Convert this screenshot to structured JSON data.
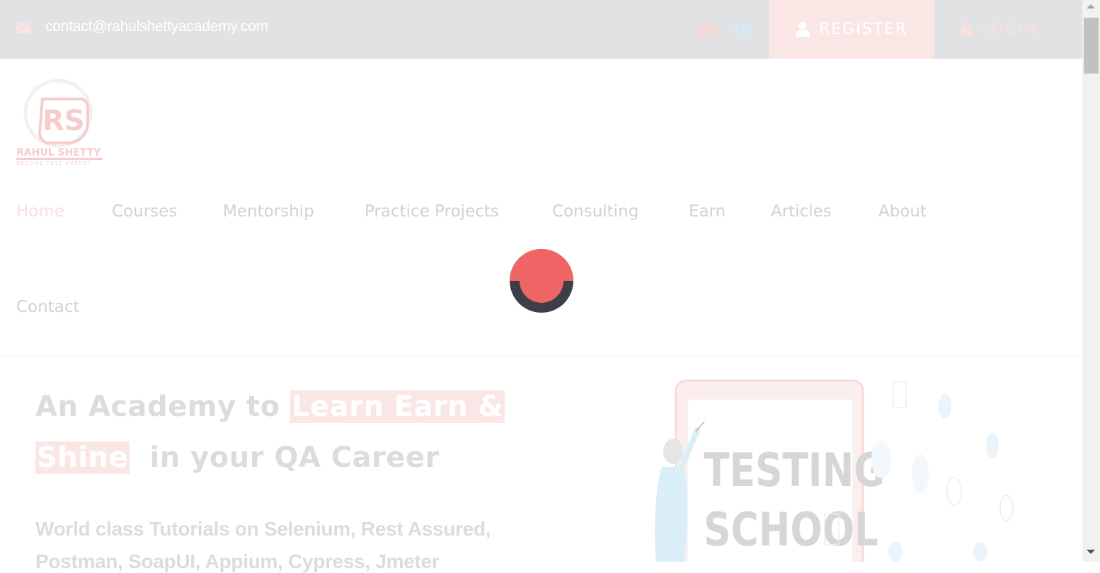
{
  "topbar": {
    "email": "contact@rahulshettyacademy.com",
    "register_label": "REGISTER",
    "login_label": "LOGIN"
  },
  "logo": {
    "monogram": "RS",
    "name": "RAHUL SHETTY",
    "tagline": "BECOME TEST EXPERT"
  },
  "nav": {
    "items": [
      {
        "label": "Home"
      },
      {
        "label": "Courses"
      },
      {
        "label": "Mentorship"
      },
      {
        "label": "Practice Projects"
      },
      {
        "label": "Consulting"
      },
      {
        "label": "Earn"
      },
      {
        "label": "Articles"
      },
      {
        "label": "About"
      },
      {
        "label": "Contact"
      }
    ]
  },
  "hero": {
    "line1_prefix": "An Academy to",
    "line1_highlight": "Learn Earn &",
    "line2_highlight": "Shine",
    "line2_suffix": "in your QA Career",
    "subtitle_line1": "World class Tutorials on Selenium, Rest Assured,",
    "subtitle_line2": "Postman, SoapUI, Appium, Cypress, Jmeter",
    "illustration_text_1": "TESTING",
    "illustration_text_2": "SCHOOL"
  },
  "icons": {
    "mail": "mail-icon",
    "youtube": "youtube-icon",
    "linkedin": "linkedin-icon",
    "user": "user-icon",
    "lock": "lock-icon",
    "spinner": "loading-spinner"
  },
  "colors": {
    "accent": "#ef6565",
    "spinner_ring": "#3c3f46",
    "topbar_bg": "#e1e2e4",
    "register_bg": "#fbe6e6"
  }
}
